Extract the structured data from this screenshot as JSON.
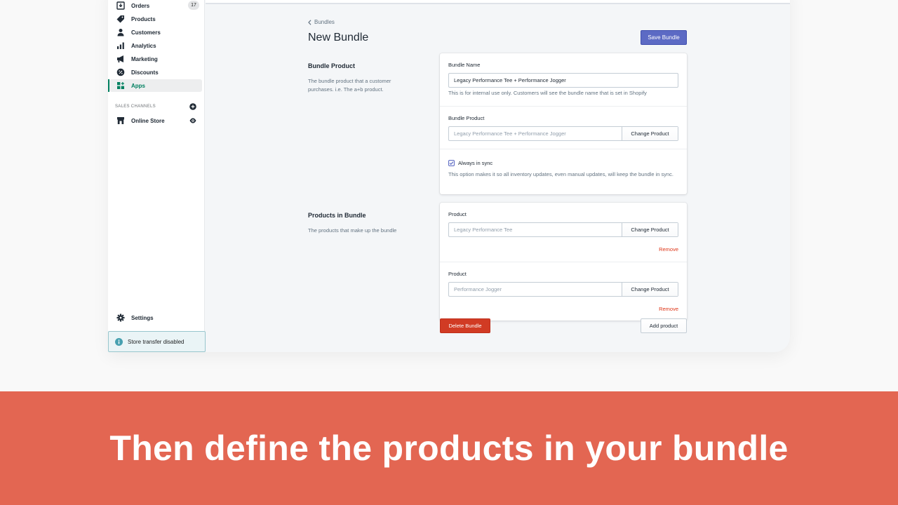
{
  "sidebar": {
    "items": [
      {
        "label": "Orders",
        "icon": "orders-icon",
        "badge": "17"
      },
      {
        "label": "Products",
        "icon": "tag-icon"
      },
      {
        "label": "Customers",
        "icon": "person-icon"
      },
      {
        "label": "Analytics",
        "icon": "bar-chart-icon"
      },
      {
        "label": "Marketing",
        "icon": "megaphone-icon"
      },
      {
        "label": "Discounts",
        "icon": "discount-icon"
      },
      {
        "label": "Apps",
        "icon": "apps-icon",
        "active": true
      }
    ],
    "sales_channels_label": "SALES CHANNELS",
    "online_store_label": "Online Store",
    "settings_label": "Settings",
    "store_transfer_label": "Store transfer disabled"
  },
  "page": {
    "breadcrumb": "Bundles",
    "title": "New Bundle",
    "save_button": "Save Bundle",
    "delete_button": "Delete Bundle",
    "add_product_button": "Add product"
  },
  "bundle_product_section": {
    "title": "Bundle Product",
    "description": "The bundle product that a customer purchases. i.e. The a+b product.",
    "bundle_name_label": "Bundle Name",
    "bundle_name_value": "Legacy Performance Tee + Performance Jogger",
    "bundle_name_help": "This is for internal use only. Customers will see the bundle name that is set in Shopify",
    "bundle_product_label": "Bundle Product",
    "bundle_product_value": "Legacy Performance Tee + Performance Jogger",
    "change_product_button": "Change Product",
    "always_in_sync_label": "Always in sync",
    "always_in_sync_checked": true,
    "always_in_sync_help": "This option makes it so all inventory updates, even manual updates, will keep the bundle in sync."
  },
  "products_in_bundle_section": {
    "title": "Products in Bundle",
    "description": "The products that make up the bundle",
    "products": [
      {
        "label": "Product",
        "value": "Legacy Performance Tee",
        "change_button": "Change Product",
        "remove_label": "Remove"
      },
      {
        "label": "Product",
        "value": "Performance Jogger",
        "change_button": "Change Product",
        "remove_label": "Remove"
      }
    ]
  },
  "banner": {
    "text": "Then define the products in your bundle",
    "color": "#e36652"
  },
  "colors": {
    "primary": "#5c6ac4",
    "danger": "#d13b24",
    "active_nav": "#008060"
  }
}
